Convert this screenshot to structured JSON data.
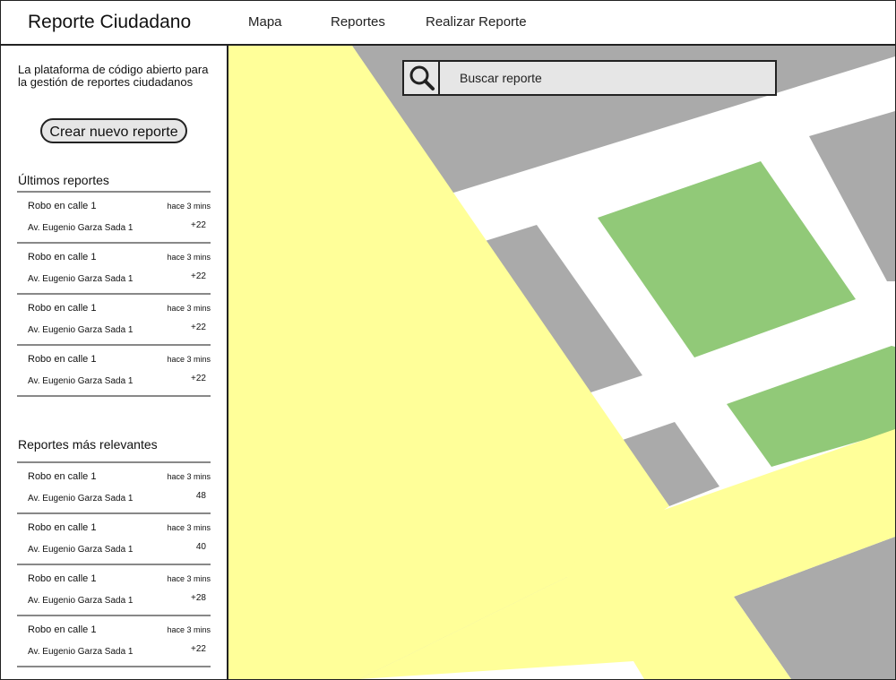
{
  "header": {
    "app_title": "Reporte Ciudadano",
    "nav": [
      {
        "label": "Mapa"
      },
      {
        "label": "Reportes"
      },
      {
        "label": "Realizar Reporte"
      }
    ]
  },
  "sidebar": {
    "tagline": "La plataforma de código abierto para la gestión de reportes ciudadanos",
    "create_button_label": "Crear nuevo reporte",
    "latest": {
      "title": "Últimos reportes",
      "items": [
        {
          "title": "Robo en calle 1",
          "time": "hace 3 mins",
          "address": "Av. Eugenio Garza Sada 1",
          "count": "+22"
        },
        {
          "title": "Robo en calle 1",
          "time": "hace 3 mins",
          "address": "Av. Eugenio Garza Sada 1",
          "count": "+22"
        },
        {
          "title": "Robo en calle 1",
          "time": "hace 3 mins",
          "address": "Av. Eugenio Garza Sada 1",
          "count": "+22"
        },
        {
          "title": "Robo en calle 1",
          "time": "hace 3 mins",
          "address": "Av. Eugenio Garza Sada 1",
          "count": "+22"
        }
      ]
    },
    "relevant": {
      "title": "Reportes más relevantes",
      "items": [
        {
          "title": "Robo en calle 1",
          "time": "hace 3 mins",
          "address": "Av. Eugenio Garza Sada 1",
          "count": "48"
        },
        {
          "title": "Robo en calle 1",
          "time": "hace 3 mins",
          "address": "Av. Eugenio Garza Sada 1",
          "count": "40"
        },
        {
          "title": "Robo en calle 1",
          "time": "hace 3 mins",
          "address": "Av. Eugenio Garza Sada 1",
          "count": "+28"
        },
        {
          "title": "Robo en calle 1",
          "time": "hace 3 mins",
          "address": "Av. Eugenio Garza Sada 1",
          "count": "+22"
        }
      ]
    }
  },
  "search": {
    "placeholder": "Buscar reporte",
    "icon": "search-icon"
  },
  "map": {
    "colors": {
      "block": "#aaaaaa",
      "road": "#ffffff",
      "main_road": "#ffff99",
      "park": "#91c978"
    }
  }
}
